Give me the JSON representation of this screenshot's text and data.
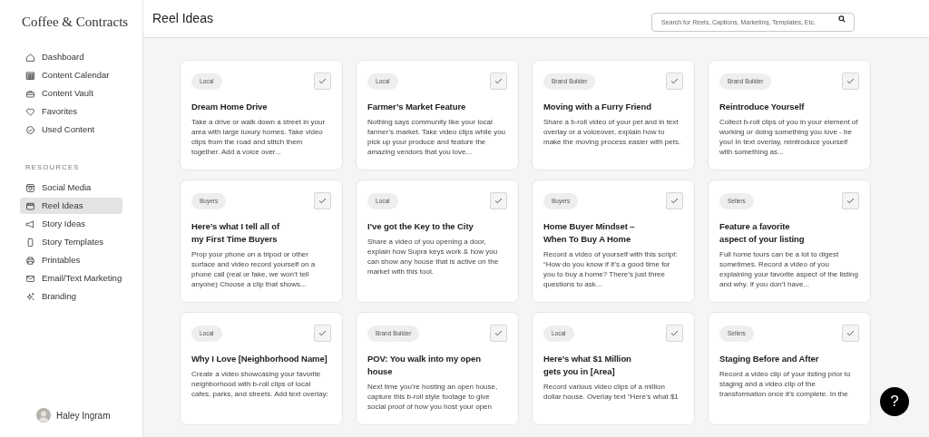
{
  "sidebar": {
    "logo": "Coffee & Contracts",
    "items": [
      {
        "label": "Dashboard",
        "selected": false
      },
      {
        "label": "Content Calendar",
        "selected": false
      },
      {
        "label": "Content Vault",
        "selected": false
      },
      {
        "label": "Favorites",
        "selected": false
      },
      {
        "label": "Used Content",
        "selected": false
      }
    ],
    "section_label": "RESOURCES",
    "resources": [
      {
        "label": "Social Media",
        "selected": false
      },
      {
        "label": "Reel Ideas",
        "selected": true
      },
      {
        "label": "Story Ideas",
        "selected": false
      },
      {
        "label": "Story Templates",
        "selected": false
      },
      {
        "label": "Printables",
        "selected": false
      },
      {
        "label": "Email/Text Marketing",
        "selected": false
      },
      {
        "label": "Branding",
        "selected": false
      }
    ],
    "user": {
      "name": "Haley Ingram"
    }
  },
  "header": {
    "title": "Reel Ideas",
    "search": {
      "placeholder": "Search for Reels, Captions, Marketing, Templates, Etc."
    }
  },
  "cards": [
    {
      "tag": "Local",
      "title": "Dream Home Drive",
      "description": "Take a drive or walk down a street in your area with large luxury homes. Take video clips from the road and stitch them together. Add a voice over..."
    },
    {
      "tag": "Local",
      "title": "Farmer’s Market Feature",
      "description": "Nothing says community like your local farmer’s market. Take video clips while you pick up your produce and feature the amazing vendors that you love..."
    },
    {
      "tag": "Brand Builder",
      "title": "Moving with a Furry Friend",
      "description": "Share a b-roll video of your pet and in text overlay or a voiceover, explain how to make the moving process easier with pets."
    },
    {
      "tag": "Brand Builder",
      "title": "Reintroduce Yourself",
      "description": "Collect b-roll clips of you in your element of working or doing something you love - be you! In text overlay, reintroduce yourself with something as..."
    },
    {
      "tag": "Buyers",
      "title": "Here’s what I tell all of\nmy First Time Buyers",
      "description": "Prop your phone on a tripod or other surface and video record yourself on a phone call (real or fake, we won’t tell anyone) Choose a clip that shows..."
    },
    {
      "tag": "Local",
      "title": "I’ve got the Key to the City",
      "description": "Share a video of you opening a door, explain how Supra keys work & how you can show any house that is active on the market with this tool."
    },
    {
      "tag": "Buyers",
      "title": "Home Buyer Mindset –\nWhen To Buy A Home",
      "description": "Record a video of yourself with this script: “How do you know if it’s a good time for you to buy a home? There’s just three questions to ask..."
    },
    {
      "tag": "Sellers",
      "title": "Feature a favorite\naspect of your listing",
      "description": "Full home tours can be a lot to digest sometimes. Record a video of you explaining your favorite aspect of the listing and why. If you don’t have..."
    },
    {
      "tag": "Local",
      "title": "Why I Love [Neighborhood Name]",
      "description": "Create a video showcasing your favorite neighborhood with b-roll clips of local cafes, parks, and streets. Add text overlay:"
    },
    {
      "tag": "Brand Builder",
      "title": "POV: You walk into my open house",
      "description": "Next time you’re hosting an open house, capture this b-roll style footage to give social proof of how you host your open"
    },
    {
      "tag": "Local",
      "title": "Here’s what $1 Million\ngets you in [Area]",
      "description": "Record various video clips of a million dollar house. Overlay text “Here’s what $1"
    },
    {
      "tag": "Sellers",
      "title": "Staging Before and After",
      "description": "Record a video clip of your listing prior to staging and a video clip of the transformation once it’s complete. In the"
    }
  ],
  "help_button": {
    "label": "?"
  }
}
